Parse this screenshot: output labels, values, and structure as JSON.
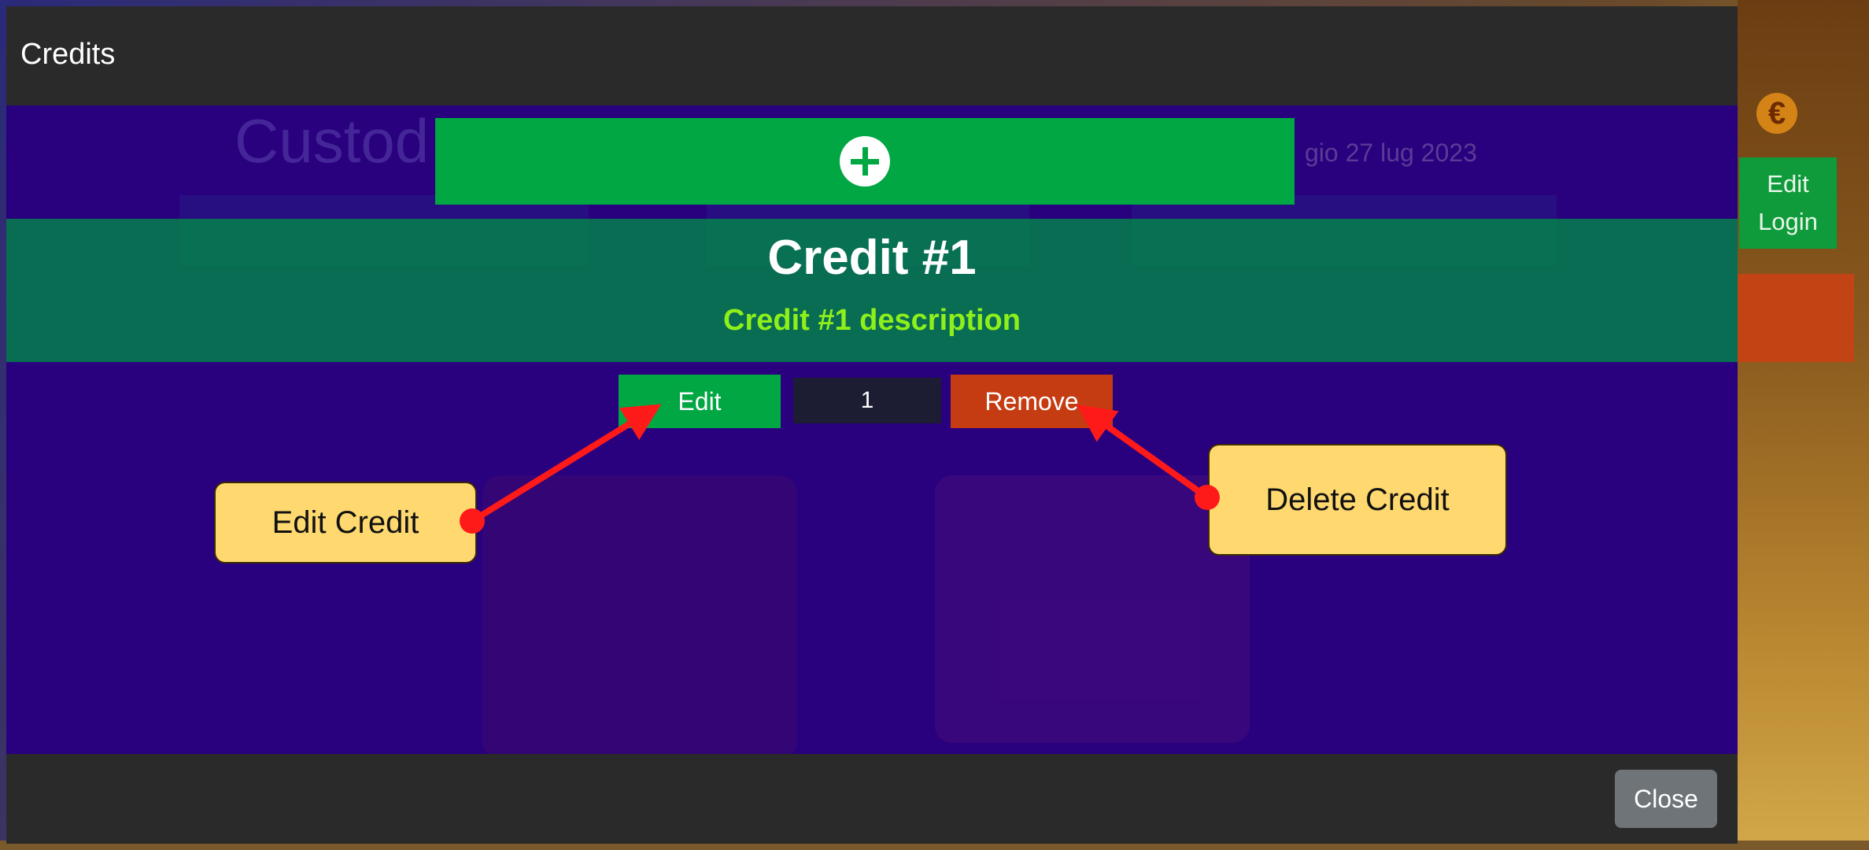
{
  "modal": {
    "title": "Credits",
    "close_label": "Close"
  },
  "background": {
    "app_title": "Custod",
    "date": "gio 27 lug 2023",
    "edit_login_line1": "Edit",
    "edit_login_line2": "Login",
    "coin_symbol": "€"
  },
  "credit": {
    "add_icon": "plus-circle-icon",
    "title": "Credit #1",
    "description": "Credit #1 description",
    "edit_label": "Edit",
    "order_value": "1",
    "remove_label": "Remove"
  },
  "callouts": {
    "edit": "Edit Credit",
    "delete": "Delete Credit"
  },
  "colors": {
    "green": "#00a742",
    "remove_red": "#c63c12",
    "modal_bg": "#29007e",
    "header_bg": "#2a2a2a",
    "callout_yellow": "#ffd970",
    "arrow_red": "#ff1a1a",
    "description_green": "#8ef01a"
  }
}
